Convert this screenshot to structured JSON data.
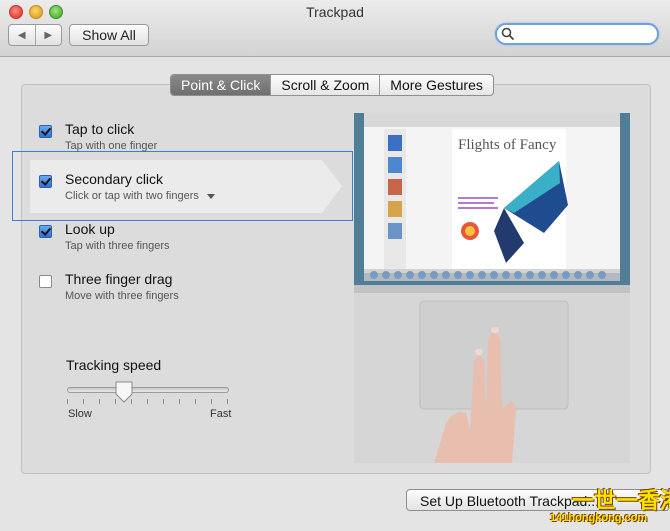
{
  "window": {
    "title": "Trackpad"
  },
  "toolbar": {
    "back_label": "◀",
    "forward_label": "▶",
    "show_all_label": "Show All",
    "search_value": ""
  },
  "tabs": [
    {
      "label": "Point & Click",
      "selected": true
    },
    {
      "label": "Scroll & Zoom",
      "selected": false
    },
    {
      "label": "More Gestures",
      "selected": false
    }
  ],
  "options": [
    {
      "title": "Tap to click",
      "subtitle": "Tap with one finger",
      "checked": true
    },
    {
      "title": "Secondary click",
      "subtitle": "Click or tap with two fingers",
      "checked": true,
      "has_dropdown": true
    },
    {
      "title": "Look up",
      "subtitle": "Tap with three fingers",
      "checked": true
    },
    {
      "title": "Three finger drag",
      "subtitle": "Move with three fingers",
      "checked": false
    }
  ],
  "tracking": {
    "label": "Tracking speed",
    "min_label": "Slow",
    "max_label": "Fast",
    "level": 0.34
  },
  "preview": {
    "doc_heading": "Flights of Fancy"
  },
  "bottom": {
    "bluetooth_button": "Set Up Bluetooth Trackpad..."
  },
  "watermark": {
    "line1": "一世一香港",
    "line2": "141hongkong.com"
  },
  "colors": {
    "accent": "#3f7fd0",
    "checkbox": "#2d72d6"
  }
}
